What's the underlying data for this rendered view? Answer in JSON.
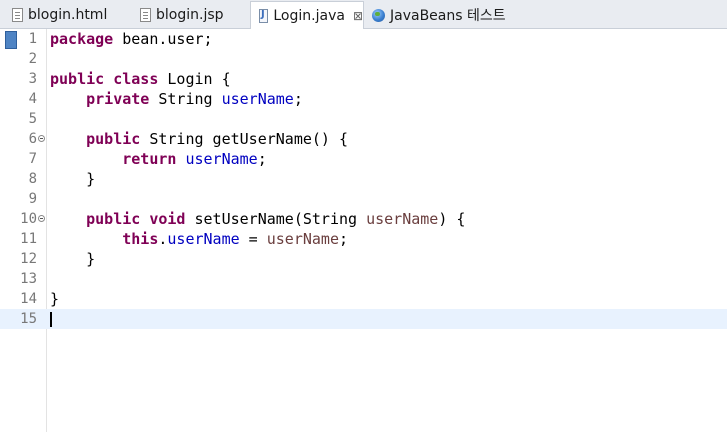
{
  "tabs": [
    {
      "label": "blogin.html",
      "icon": "html-file-icon",
      "active": false
    },
    {
      "label": "blogin.jsp",
      "icon": "jsp-file-icon",
      "active": false
    },
    {
      "label": "Login.java",
      "icon": "java-file-icon",
      "active": true,
      "close": "⊠"
    },
    {
      "label": "JavaBeans 테스트",
      "icon": "globe-icon",
      "active": false
    }
  ],
  "editor": {
    "current_line": 15,
    "lines": [
      {
        "n": "1",
        "tokens": [
          {
            "t": "package",
            "c": "kw"
          },
          {
            "t": " bean.user;",
            "c": ""
          }
        ]
      },
      {
        "n": "2",
        "tokens": []
      },
      {
        "n": "3",
        "tokens": [
          {
            "t": "public",
            "c": "kw"
          },
          {
            "t": " ",
            "c": ""
          },
          {
            "t": "class",
            "c": "kw"
          },
          {
            "t": " Login {",
            "c": ""
          }
        ]
      },
      {
        "n": "4",
        "tokens": [
          {
            "t": "    ",
            "c": ""
          },
          {
            "t": "private",
            "c": "kw"
          },
          {
            "t": " String ",
            "c": ""
          },
          {
            "t": "userName",
            "c": "fld"
          },
          {
            "t": ";",
            "c": ""
          }
        ]
      },
      {
        "n": "5",
        "tokens": []
      },
      {
        "n": "6",
        "fold": true,
        "tokens": [
          {
            "t": "    ",
            "c": ""
          },
          {
            "t": "public",
            "c": "kw"
          },
          {
            "t": " String getUserName() {",
            "c": ""
          }
        ]
      },
      {
        "n": "7",
        "tokens": [
          {
            "t": "        ",
            "c": ""
          },
          {
            "t": "return",
            "c": "kw"
          },
          {
            "t": " ",
            "c": ""
          },
          {
            "t": "userName",
            "c": "fld"
          },
          {
            "t": ";",
            "c": ""
          }
        ]
      },
      {
        "n": "8",
        "tokens": [
          {
            "t": "    }",
            "c": ""
          }
        ]
      },
      {
        "n": "9",
        "tokens": []
      },
      {
        "n": "10",
        "fold": true,
        "tokens": [
          {
            "t": "    ",
            "c": ""
          },
          {
            "t": "public",
            "c": "kw"
          },
          {
            "t": " ",
            "c": ""
          },
          {
            "t": "void",
            "c": "kw"
          },
          {
            "t": " setUserName(String ",
            "c": ""
          },
          {
            "t": "userName",
            "c": "par"
          },
          {
            "t": ") {",
            "c": ""
          }
        ]
      },
      {
        "n": "11",
        "tokens": [
          {
            "t": "        ",
            "c": ""
          },
          {
            "t": "this",
            "c": "kw"
          },
          {
            "t": ".",
            "c": ""
          },
          {
            "t": "userName",
            "c": "fld"
          },
          {
            "t": " = ",
            "c": ""
          },
          {
            "t": "userName",
            "c": "par"
          },
          {
            "t": ";",
            "c": ""
          }
        ]
      },
      {
        "n": "12",
        "tokens": [
          {
            "t": "    }",
            "c": ""
          }
        ]
      },
      {
        "n": "13",
        "tokens": []
      },
      {
        "n": "14",
        "tokens": [
          {
            "t": "}",
            "c": ""
          }
        ]
      },
      {
        "n": "15",
        "tokens": []
      }
    ]
  },
  "colors": {
    "keyword": "#7f0055",
    "field": "#0000c0",
    "parameter": "#6a3e3e",
    "current_line_bg": "#e8f2fe"
  }
}
